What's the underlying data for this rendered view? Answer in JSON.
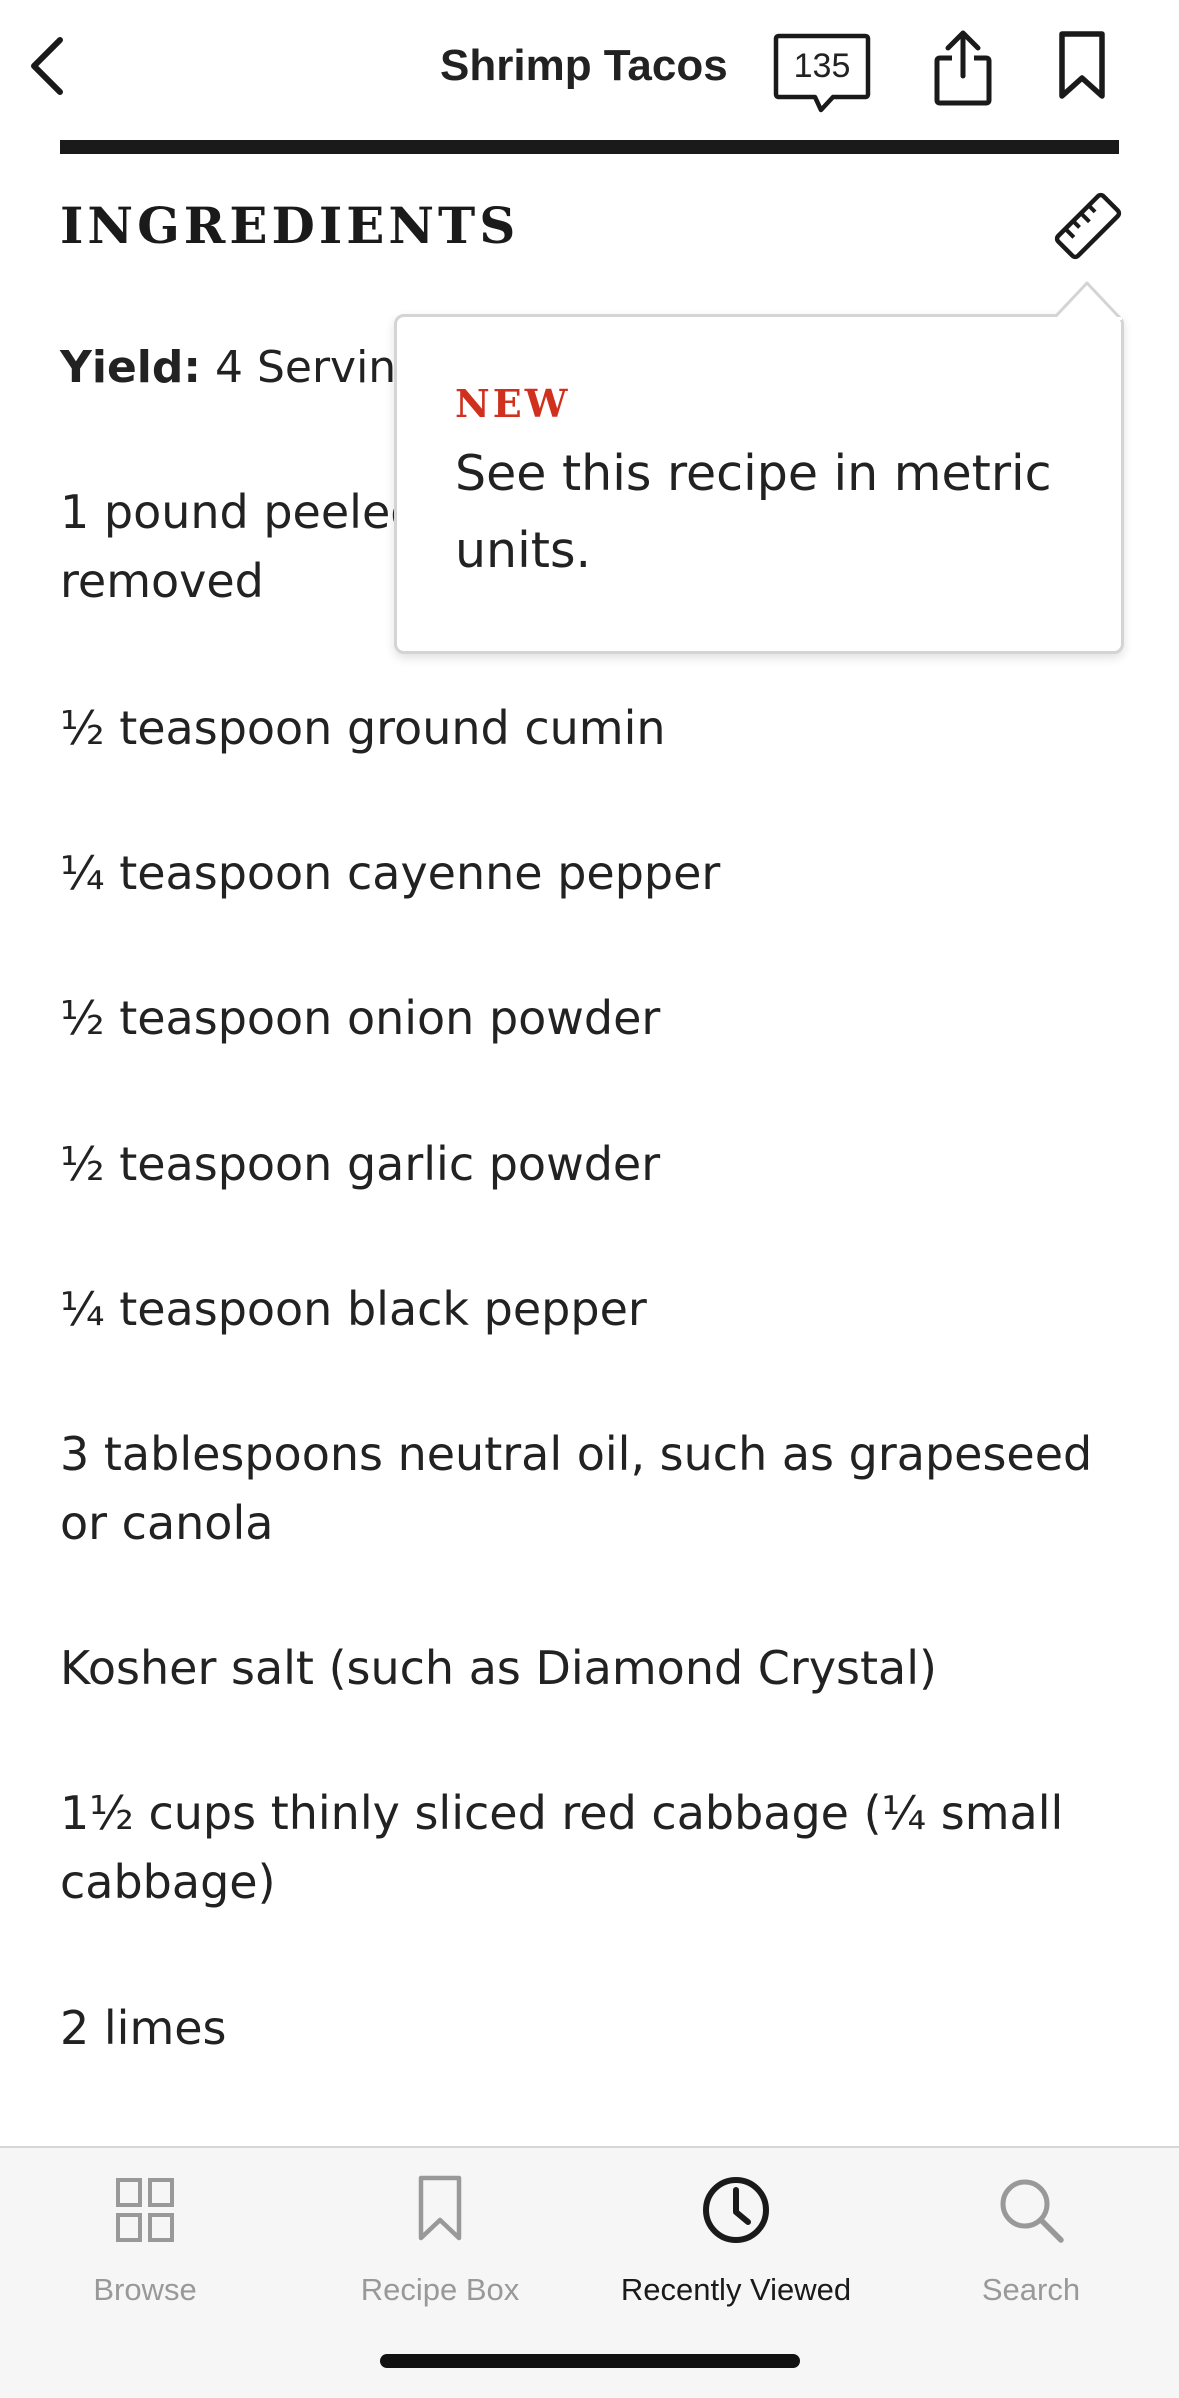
{
  "header": {
    "title": "Shrimp Tacos",
    "comment_count": "135"
  },
  "ingredients": {
    "heading": "INGREDIENTS",
    "yield_label": "Yield:",
    "yield_value": "4 Servings",
    "items": [
      "1 pound peeled and deveined shrimp, tails removed",
      "½ teaspoon ground cumin",
      "¼ teaspoon cayenne pepper",
      "½ teaspoon onion powder",
      "½ teaspoon garlic powder",
      "¼ teaspoon black pepper",
      "3 tablespoons neutral oil, such as grapeseed or canola",
      "Kosher salt (such as Diamond Crystal)",
      "1½ cups thinly sliced red cabbage (¼ small cabbage)",
      "2 limes"
    ]
  },
  "tooltip": {
    "badge": "NEW",
    "text": "See this recipe in metric units."
  },
  "tabbar": {
    "tabs": [
      {
        "label": "Browse",
        "icon": "grid-icon"
      },
      {
        "label": "Recipe Box",
        "icon": "bookmark-icon"
      },
      {
        "label": "Recently Viewed",
        "icon": "clock-icon"
      },
      {
        "label": "Search",
        "icon": "search-icon"
      }
    ],
    "active": "Recently Viewed"
  },
  "colors": {
    "accent_red": "#d0311f",
    "text": "#222222",
    "inactive_tab": "#999999"
  }
}
